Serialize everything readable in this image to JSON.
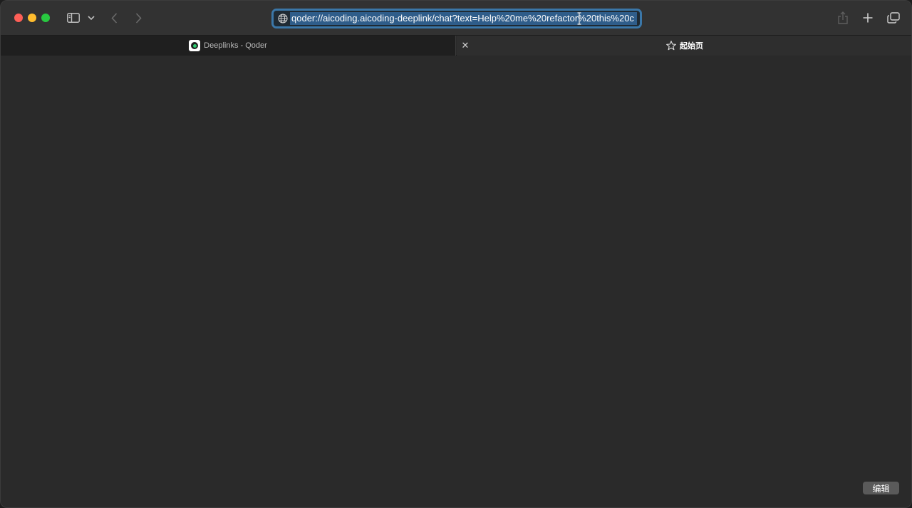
{
  "toolbar": {
    "address_url": "qoder://aicoding.aicoding-deeplink/chat?text=Help%20me%20refactor%20this%20c",
    "icons": [
      "sidebar-icon",
      "chevron-down-icon",
      "back-icon",
      "forward-icon",
      "globe-icon",
      "share-icon",
      "plus-icon",
      "tabs-overview-icon"
    ]
  },
  "tabs": [
    {
      "title": "Deeplinks - Qoder",
      "active": false
    },
    {
      "title": "起始页",
      "active": true
    }
  ],
  "content": {
    "edit_label": "编辑"
  },
  "colors": {
    "address_focus": "#3b77a8",
    "selection": "#2f5d8a"
  }
}
